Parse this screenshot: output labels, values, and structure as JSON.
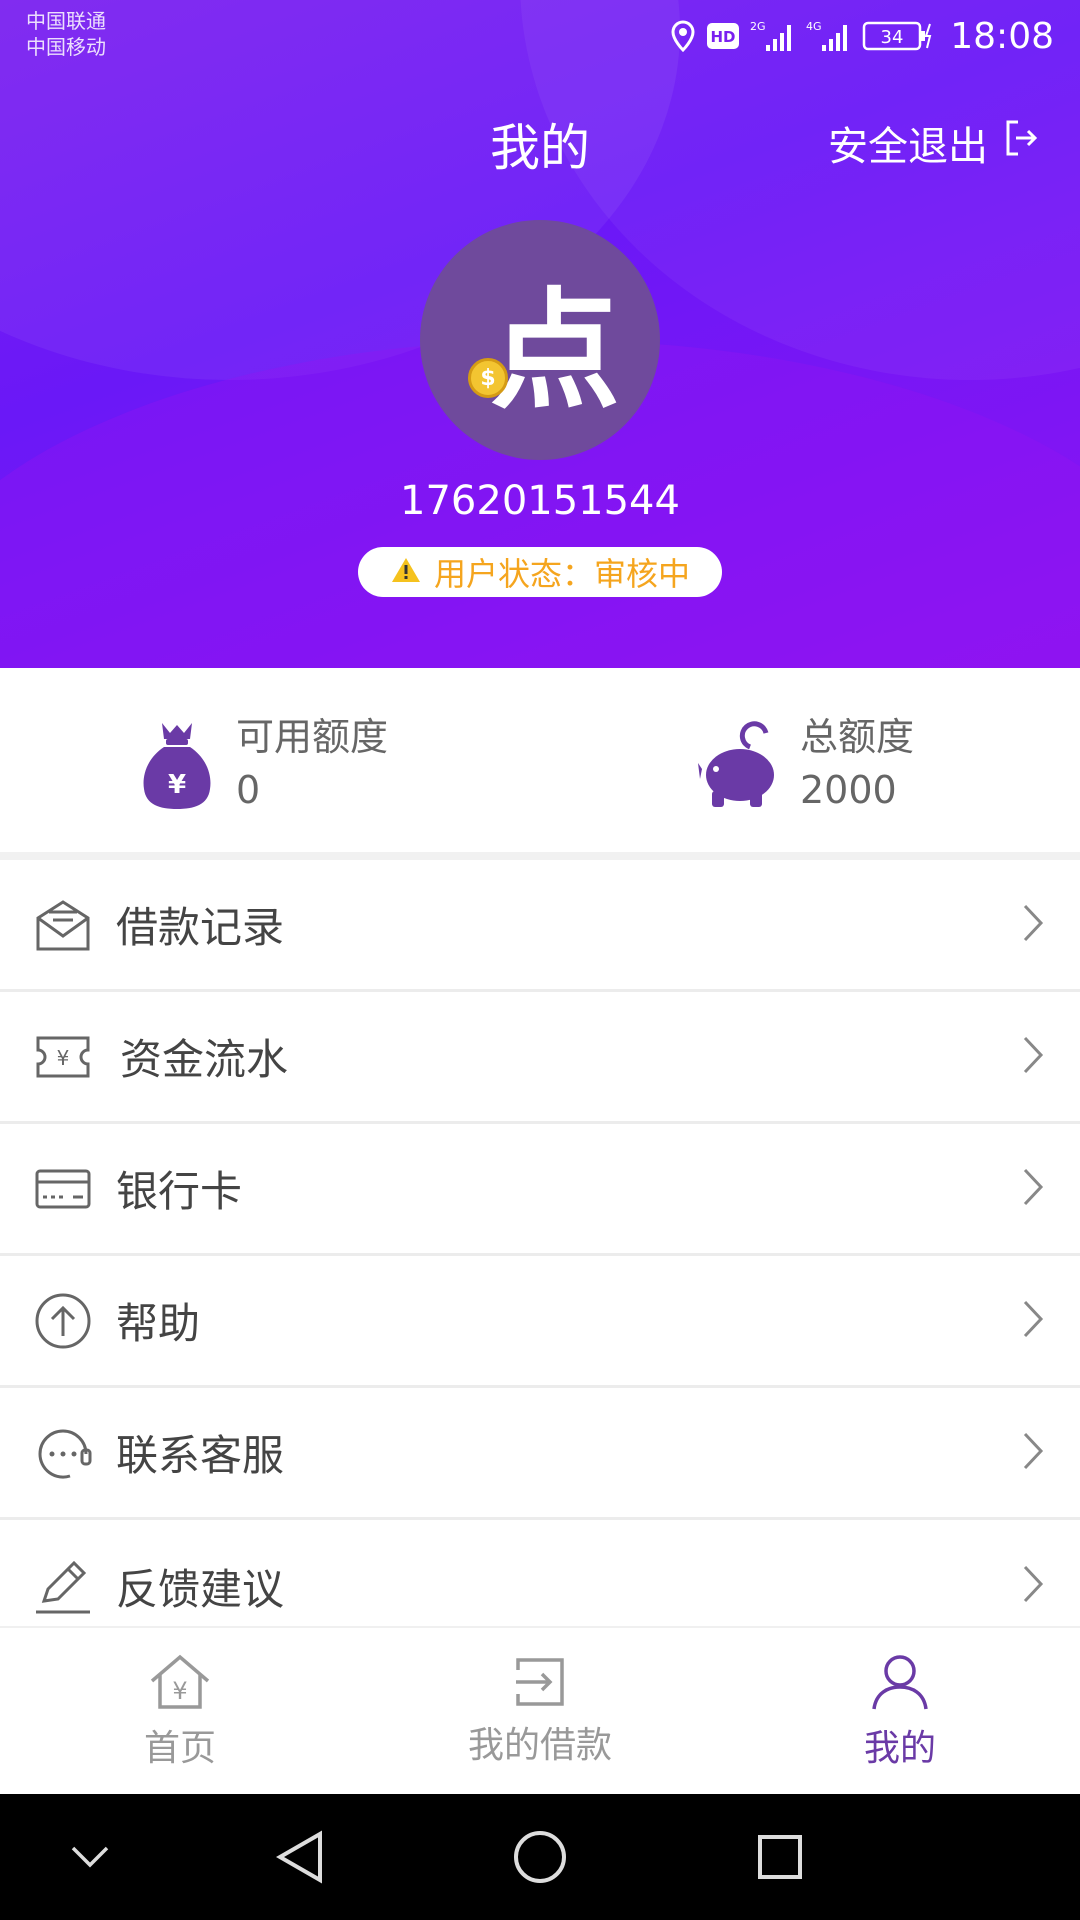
{
  "status_bar": {
    "carrier_1": "中国联通",
    "carrier_2": "中国移动",
    "network_1": "2G",
    "network_2": "4G",
    "battery": "34",
    "time": "18:08"
  },
  "header": {
    "title": "我的",
    "logout_label": "安全退出",
    "avatar_text": "点",
    "coin_symbol": "$",
    "phone": "17620151544",
    "status_text": "用户状态：审核中"
  },
  "quota": {
    "available_label": "可用额度",
    "available_value": "0",
    "available_icon_symbol": "¥",
    "total_label": "总额度",
    "total_value": "2000"
  },
  "menu": {
    "items": [
      {
        "label": "借款记录",
        "icon": "envelope-icon"
      },
      {
        "label": "资金流水",
        "icon": "ticket-yen-icon",
        "icon_symbol": "¥"
      },
      {
        "label": "银行卡",
        "icon": "bank-card-icon"
      },
      {
        "label": "帮助",
        "icon": "arrow-up-circle-icon"
      },
      {
        "label": "联系客服",
        "icon": "headset-icon"
      },
      {
        "label": "反馈建议",
        "icon": "pen-icon"
      }
    ]
  },
  "tabbar": {
    "home_label": "首页",
    "home_icon_symbol": "¥",
    "loans_label": "我的借款",
    "mine_label": "我的",
    "active": "mine"
  },
  "colors": {
    "header_gradient_start": "#7a1ff0",
    "header_gradient_end": "#8c13f2",
    "accent_purple": "#6a3aa6",
    "status_orange": "#f5a51e"
  }
}
